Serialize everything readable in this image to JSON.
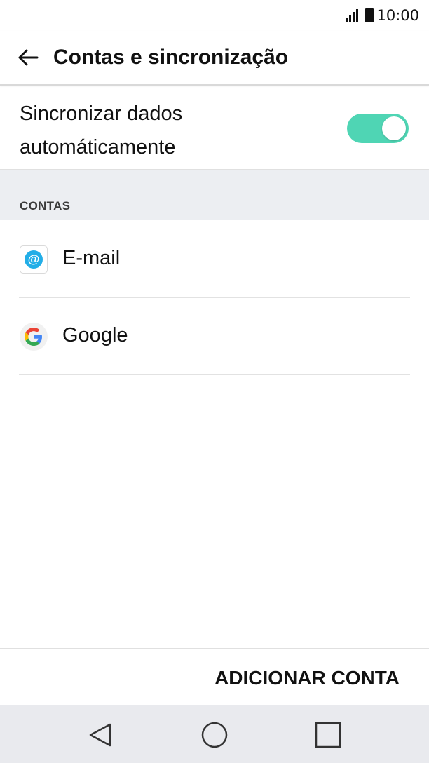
{
  "status_bar": {
    "time": "10:00",
    "icons": [
      "signal-icon",
      "battery-icon"
    ]
  },
  "app_bar": {
    "back_icon": "arrow-left-icon",
    "title": "Contas e sincronização"
  },
  "sync": {
    "label": "Sincronizar dados automáticamente",
    "enabled": true,
    "toggle_color": "#4fd5b4"
  },
  "section": {
    "title": "CONTAS"
  },
  "accounts": [
    {
      "icon": "email-at-icon",
      "label": "E-mail"
    },
    {
      "icon": "google-g-icon",
      "label": "Google"
    }
  ],
  "bottom": {
    "add_button_label": "ADICIONAR CONTA"
  },
  "nav": {
    "buttons": [
      "back-triangle-icon",
      "home-circle-icon",
      "recents-square-icon"
    ]
  },
  "colors": {
    "section_bg": "#eceef2",
    "nav_bg": "#e9eaee",
    "email_blue": "#23aee7"
  }
}
